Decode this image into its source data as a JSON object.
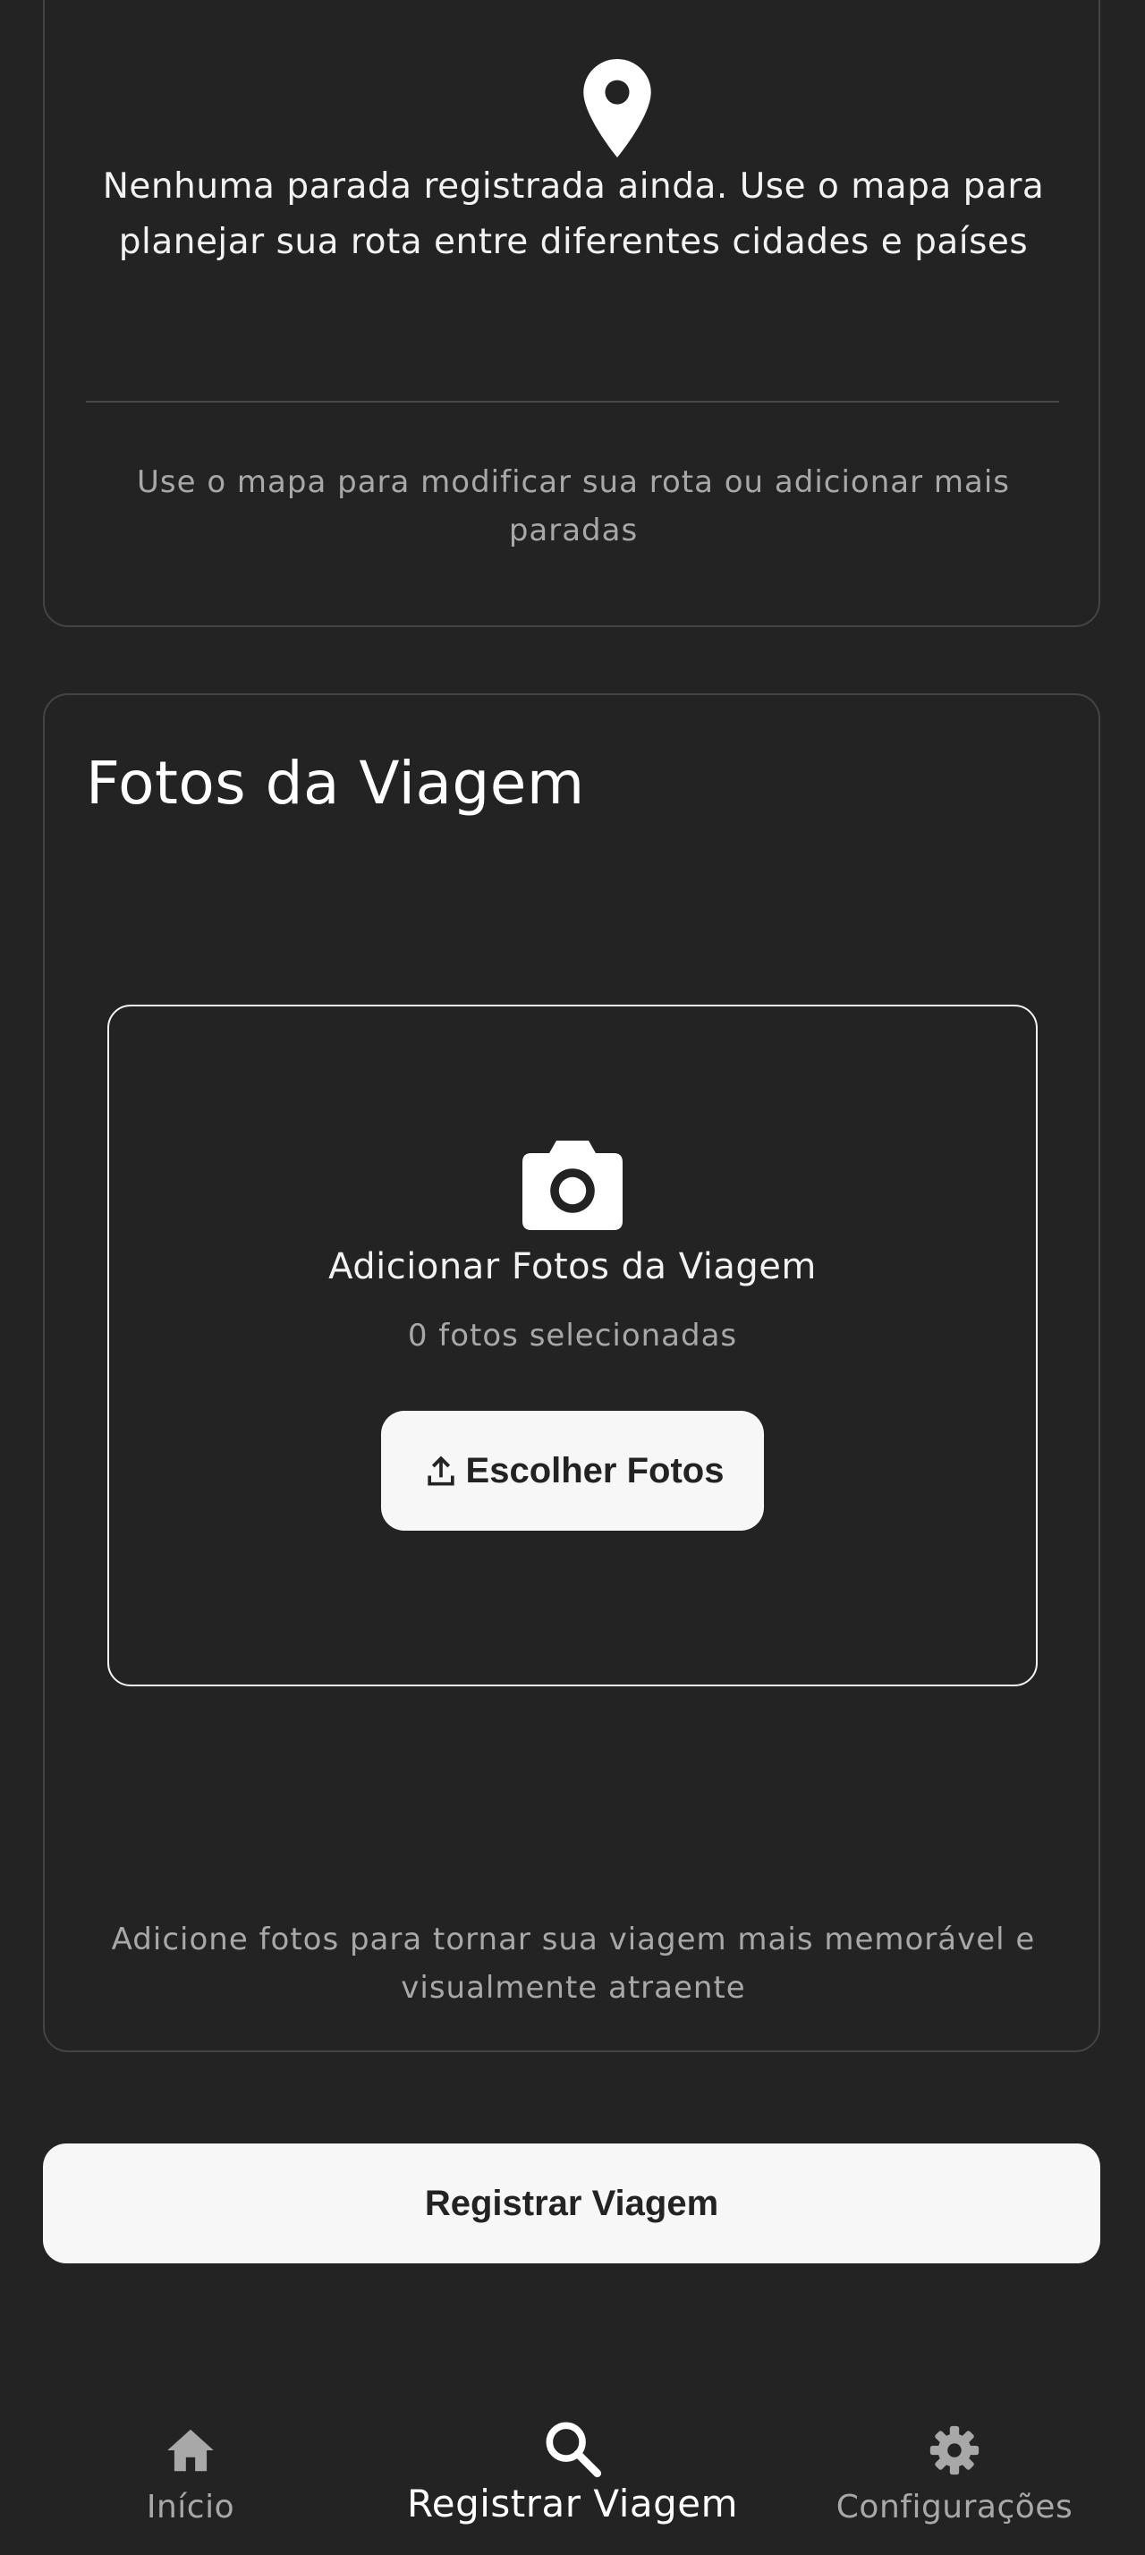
{
  "stops": {
    "empty_message": "Nenhuma parada registrada ainda. Use o mapa para planejar sua rota entre diferentes cidades e países",
    "hint": "Use o mapa para modificar sua rota ou adicionar mais paradas",
    "icon": "location-pin-icon"
  },
  "photos": {
    "title": "Fotos da Viagem",
    "upload_title": "Adicionar Fotos da Viagem",
    "selected_count": "0 fotos selecionadas",
    "choose_button": "Escolher Fotos",
    "hint": "Adicione fotos para tornar sua viagem mais memorável e visualmente atraente",
    "icons": [
      "camera-icon",
      "upload-icon"
    ]
  },
  "submit_button": "Registrar Viagem",
  "bottom_nav": {
    "items": [
      {
        "label": "Início",
        "icon": "home-icon",
        "active": false
      },
      {
        "label": "Registrar Viagem",
        "icon": "search-icon",
        "active": true
      },
      {
        "label": "Configurações",
        "icon": "gear-icon",
        "active": false
      }
    ]
  },
  "colors": {
    "background": "#232323",
    "card_border": "#444444",
    "text_primary": "#ffffff",
    "text_secondary": "#a8a8a8",
    "button_background": "#f7f7f7",
    "button_text": "#232323"
  }
}
